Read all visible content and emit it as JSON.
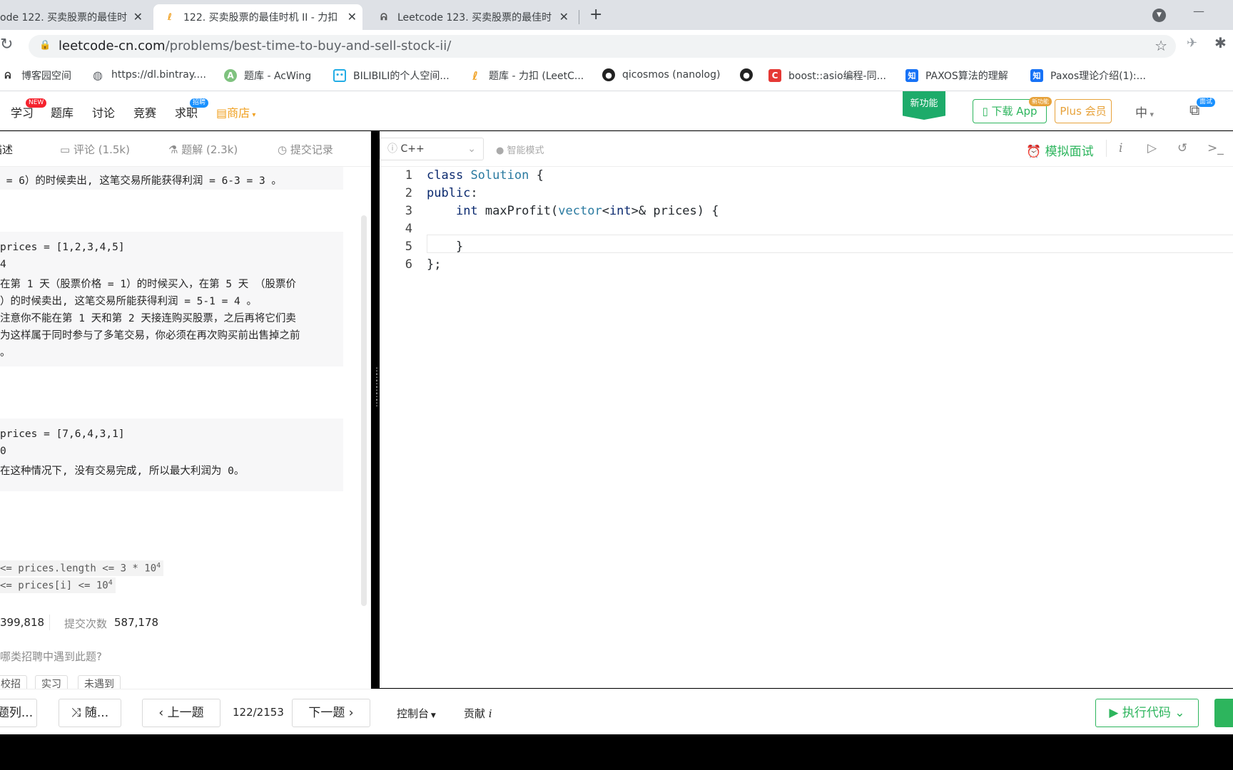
{
  "browser": {
    "tabs": [
      {
        "title": "ode 122. 买卖股票的最佳时",
        "active": false
      },
      {
        "title": "122. 买卖股票的最佳时机 II - 力扣",
        "active": true
      },
      {
        "title": "Leetcode 123. 买卖股票的最佳时",
        "active": false
      }
    ],
    "url_host": "leetcode-cn.com",
    "url_path": "/problems/best-time-to-buy-and-sell-stock-ii/",
    "bookmarks": [
      {
        "label": "博客园空间",
        "icon": "cnblogs-icon"
      },
      {
        "label": "https://dl.bintray....",
        "icon": "globe-icon"
      },
      {
        "label": "题库 - AcWing",
        "icon": "acwing-icon"
      },
      {
        "label": "BILIBILI的个人空间...",
        "icon": "bilibili-icon"
      },
      {
        "label": "题库 - 力扣 (LeetC...",
        "icon": "leetcode-icon"
      },
      {
        "label": "qicosmos (nanolog)",
        "icon": "github-icon"
      },
      {
        "label": "",
        "icon": "github-icon"
      },
      {
        "label": "boost::asio编程-同...",
        "icon": "csdn-icon"
      },
      {
        "label": "PAXOS算法的理解",
        "icon": "zhihu-icon"
      },
      {
        "label": "Paxos理论介绍(1):...",
        "icon": "zhihu-icon"
      }
    ]
  },
  "nav": {
    "items": [
      "学习",
      "题库",
      "讨论",
      "竞赛",
      "求职"
    ],
    "store": "商店",
    "badge_new": "NEW",
    "badge_hiring": "招聘",
    "new_feature": "新功能",
    "download_app": "下载 App",
    "download_badge": "新功能",
    "plus": "Plus 会员",
    "lang": "中",
    "interview_badge": "面试"
  },
  "left": {
    "tabs": {
      "desc": "描述",
      "comments": "评论 (1.5k)",
      "solutions": "题解 (2.3k)",
      "submissions": "提交记录"
    },
    "ex1_tail": " = 6）的时候卖出, 这笔交易所能获得利润 = 6-3 = 3 。",
    "ex2_lines": [
      "prices = [1,2,3,4,5]",
      "4",
      "在第 1 天（股票价格 = 1）的时候买入，在第 5 天 （股票价",
      "）的时候卖出, 这笔交易所能获得利润 = 5-1 = 4 。",
      "注意你不能在第 1 天和第 2 天接连购买股票，之后再将它们卖",
      "为这样属于同时参与了多笔交易，你必须在再次购买前出售掉之前",
      "。"
    ],
    "ex3_lines": [
      "prices = [7,6,4,3,1]",
      "0",
      "在这种情况下, 没有交易完成, 所以最大利润为 0。"
    ],
    "constraint1": "<= prices.length <= 3 * 10",
    "constraint2": "<= prices[i] <= 10",
    "exp": "4",
    "passed": "399,818",
    "submit_label": "提交次数",
    "submit_count": "587,178",
    "question": "哪类招聘中遇到此题?",
    "chips": [
      "校招",
      "实习",
      "未遇到"
    ]
  },
  "editor": {
    "language": "C++",
    "smart_mode": "智能模式",
    "mock_interview": "模拟面试",
    "line_numbers": [
      "1",
      "2",
      "3",
      "4",
      "5",
      "6"
    ]
  },
  "bottom": {
    "list_btn": "题列...",
    "random_btn": "随...",
    "prev": "上一题",
    "progress": "122/2153",
    "next": "下一题",
    "console": "控制台",
    "contribute": "贡献",
    "run": "执行代码"
  }
}
